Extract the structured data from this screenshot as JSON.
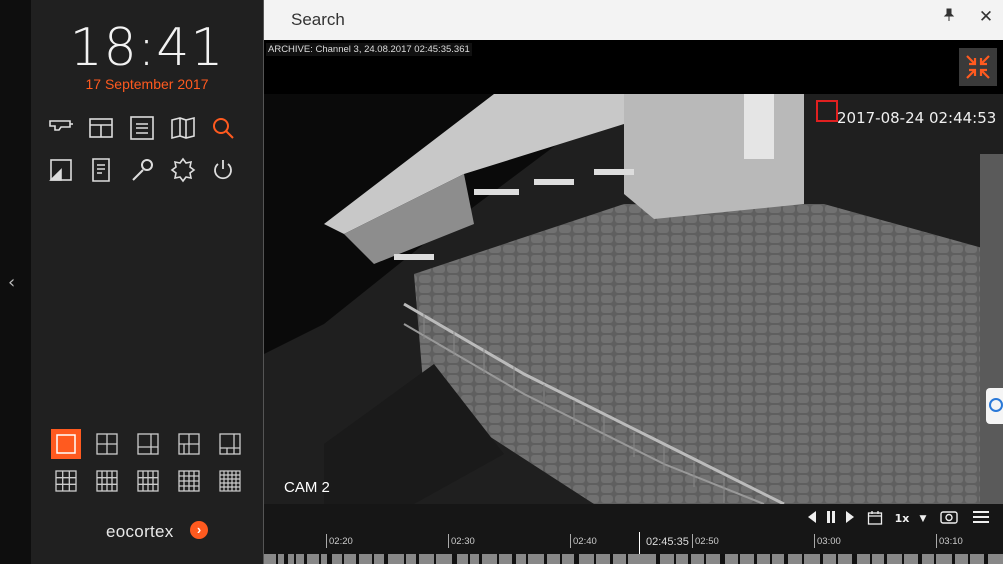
{
  "clock": {
    "time": "18:41",
    "date": "17 September 2017"
  },
  "sidebar": {
    "tools": [
      {
        "name": "cameras-icon"
      },
      {
        "name": "layouts-icon"
      },
      {
        "name": "list-icon"
      },
      {
        "name": "map-icon"
      },
      {
        "name": "search-icon",
        "active": true
      },
      {
        "name": "image-icon"
      },
      {
        "name": "report-icon"
      },
      {
        "name": "wrench-icon"
      },
      {
        "name": "settings-icon"
      },
      {
        "name": "power-icon"
      }
    ],
    "layouts": [
      {
        "name": "layout-1x1",
        "active": true
      },
      {
        "name": "layout-2x2"
      },
      {
        "name": "layout-1plus3"
      },
      {
        "name": "layout-2x2-alt"
      },
      {
        "name": "layout-1plus5"
      },
      {
        "name": "layout-3x3"
      },
      {
        "name": "layout-3x3-alt"
      },
      {
        "name": "layout-4x3"
      },
      {
        "name": "layout-4x4"
      },
      {
        "name": "layout-5x5"
      }
    ],
    "logo": "eocortex",
    "logo_badge": "›"
  },
  "panel": {
    "title": "Search",
    "pin_icon": "pin-icon",
    "close_label": "✕",
    "archive_label": "ARCHIVE: Channel 3, 24.08.2017 02:45:35.361",
    "video_timestamp": "2017-08-24 02:44:53",
    "camera_label": "CAM 2"
  },
  "controls": {
    "speed": "1x",
    "timeline": {
      "ticks": [
        "02:20",
        "02:30",
        "02:40",
        "02:50",
        "03:00",
        "03:10"
      ],
      "current": "02:45:35"
    }
  },
  "colors": {
    "accent": "#ff5a1f",
    "sidebar_bg": "#202020",
    "panel_bg": "#000000"
  }
}
